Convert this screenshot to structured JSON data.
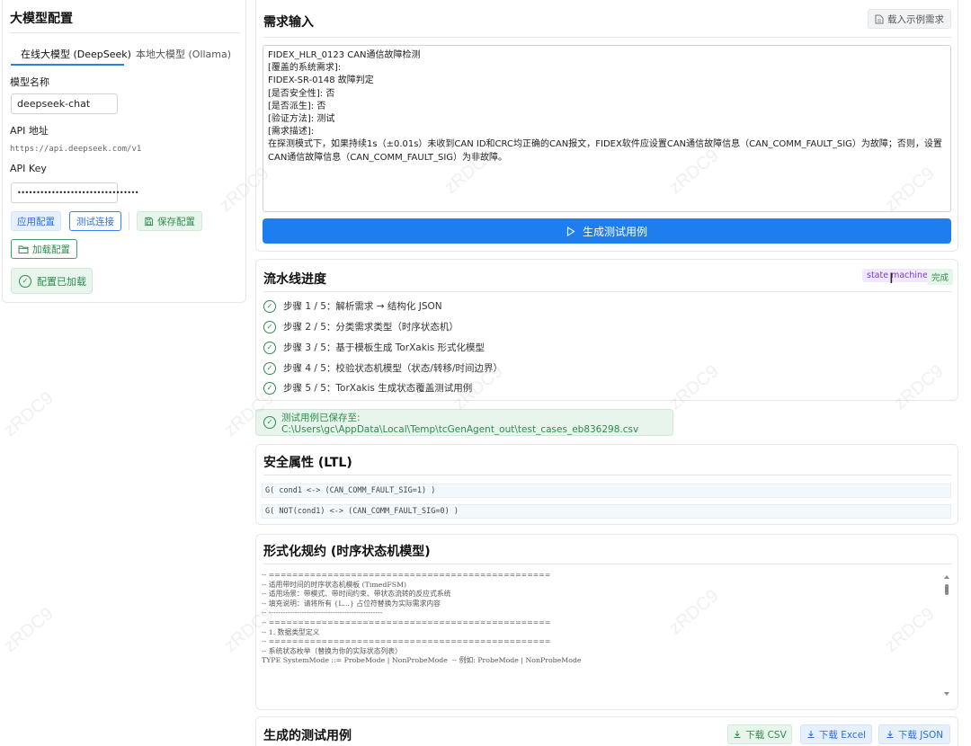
{
  "sidebar": {
    "title": "大模型配置",
    "tabs": [
      "在线大模型 (DeepSeek)",
      "本地大模型 (Ollama)"
    ],
    "model_name_label": "模型名称",
    "model_name_value": "deepseek-chat",
    "api_url_label": "API 地址",
    "api_url_value": "https://api.deepseek.com/v1",
    "api_key_label": "API Key",
    "api_key_value": "••••••••••••••••••••••••••••••••",
    "apply_label": "应用配置",
    "test_label": "测试连接",
    "save_label": "保存配置",
    "load_label": "加载配置",
    "status_text": "配置已加载"
  },
  "requirement": {
    "title": "需求输入",
    "load_example_label": "载入示例需求",
    "lines": [
      "FIDEX_HLR_0123 CAN通信故障检测",
      "[覆盖的系统需求]:",
      "FIDEX-SR-0148 故障判定",
      "[是否安全性]: 否",
      "[是否派生]: 否",
      "[验证方法]: 测试",
      "[需求描述]:",
      "在探测模式下，如果持续1s（±0.01s）未收到CAN ID和CRC均正确的CAN报文，FIDEX软件应设置CAN通信故障信息（CAN_COMM_FAULT_SIG）为故障；否则，设置CAN通信故障信息（CAN_COMM_FAULT_SIG）为非故障。"
    ],
    "generate_label": "生成测试用例"
  },
  "pipeline": {
    "title": "流水线进度",
    "badge_type": "state machine",
    "badge_status": "完成",
    "steps": [
      "步骤 1 / 5：解析需求 → 结构化 JSON",
      "步骤 2 / 5：分类需求类型（时序状态机）",
      "步骤 3 / 5：基于模板生成 TorXakis 形式化模型",
      "步骤 4 / 5：校验状态机模型（状态/转移/时间边界）",
      "步骤 5 / 5：TorXakis 生成状态覆盖测试用例"
    ]
  },
  "saved_path": "测试用例已保存至: C:\\Users\\gc\\AppData\\Local\\Temp\\tcGenAgent_out\\test_cases_eb836298.csv",
  "ltl": {
    "title": "安全属性 (LTL)",
    "rows": [
      "G( cond1 <-> (CAN_COMM_FAULT_SIG=1) )",
      "G( NOT(cond1) <-> (CAN_COMM_FAULT_SIG=0) )"
    ]
  },
  "formal": {
    "title": "形式化规约 (时序状态机模型)",
    "lines": [
      "-- ================================================",
      "-- 适用带时间的时序状态机模板 (TimedFSM)",
      "-- 适用场景：带模式、带时间约束、带状态流转的反应式系统",
      "-- 填充说明：请将所有 {L...} 占位符替换为实际需求内容",
      "-- ------------------------------------------------",
      "",
      "-- ================================================",
      "-- 1. 数据类型定义",
      "-- ================================================",
      "-- 系统状态枚举（替换为你的实际状态列表）",
      "TYPE SystemMode ::= ProbeMode | NonProbeMode  -- 例如: ProbeMode | NonProbeMode"
    ]
  },
  "tests": {
    "title": "生成的测试用例",
    "csv_label": "下载 CSV",
    "excel_label": "下载 Excel",
    "json_label": "下载 JSON"
  },
  "watermark": "zRDC9",
  "colors": {
    "primary": "#1e7ef0",
    "success": "#2e8b4e",
    "accent_purple": "#7a3fc0"
  }
}
